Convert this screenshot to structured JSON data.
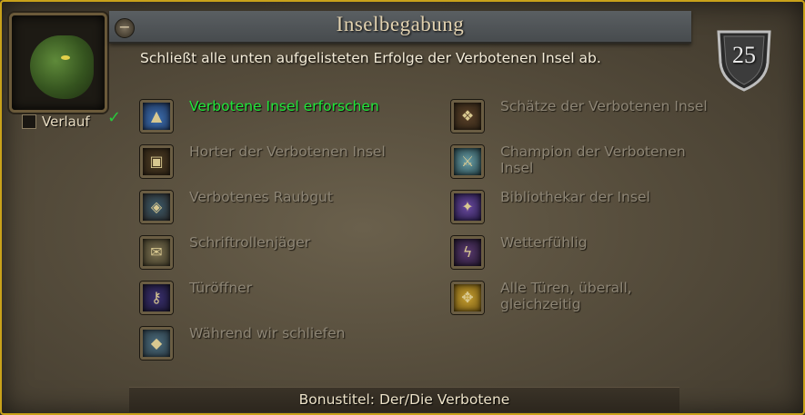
{
  "title": "Inselbegabung",
  "description": "Schließt alle unten aufgelisteten Erfolge der Verbotenen Insel ab.",
  "points": "25",
  "history_label": "Verlauf",
  "collapse_glyph": "−",
  "check_glyph": "✓",
  "footer": "Bonustitel: Der/Die Verbotene",
  "colors": {
    "completed": "#21e63a",
    "incomplete": "#8d8575",
    "frame_gold": "#c9a21a"
  },
  "criteria_left": [
    {
      "label": "Verbotene Insel erforschen",
      "completed": true,
      "icon": "island-map-icon"
    },
    {
      "label": "Horter der Verbotenen Insel",
      "completed": false,
      "icon": "treasure-chest-icon"
    },
    {
      "label": "Verbotenes Raubgut",
      "completed": false,
      "icon": "loot-icon"
    },
    {
      "label": "Schriftrollenjäger",
      "completed": false,
      "icon": "scroll-icon"
    },
    {
      "label": "Türöffner",
      "completed": false,
      "icon": "key-icon"
    },
    {
      "label": "Während wir schliefen",
      "completed": false,
      "icon": "stone-rune-icon"
    }
  ],
  "criteria_right": [
    {
      "label": "Schätze der Verbotenen Insel",
      "completed": false,
      "icon": "treasure-icon"
    },
    {
      "label": "Champion der Verbotenen Insel",
      "completed": false,
      "icon": "sword-icon"
    },
    {
      "label": "Bibliothekar der Insel",
      "completed": false,
      "icon": "tome-icon"
    },
    {
      "label": "Wetterfühlig",
      "completed": false,
      "icon": "lightning-icon"
    },
    {
      "label": "Alle Türen, überall, gleichzeitig",
      "completed": false,
      "icon": "door-map-icon"
    }
  ]
}
